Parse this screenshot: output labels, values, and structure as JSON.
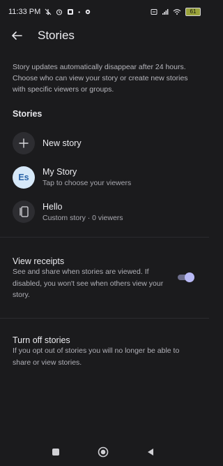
{
  "status_bar": {
    "time": "11:33 PM",
    "battery": "61"
  },
  "header": {
    "title": "Stories"
  },
  "intro_text": "Story updates automatically disappear after 24 hours. Choose who can view your story or create new stories with specific viewers or groups.",
  "stories_section": {
    "title": "Stories",
    "items": [
      {
        "primary": "New story",
        "secondary": "",
        "icon": "plus-icon"
      },
      {
        "primary": "My Story",
        "secondary": "Tap to choose your viewers",
        "avatar_text": "Es"
      },
      {
        "primary": "Hello",
        "secondary": "Custom story · 0 viewers",
        "icon": "custom-story-icon"
      }
    ]
  },
  "view_receipts": {
    "title": "View receipts",
    "description": "See and share when stories are viewed. If disabled, you won't see when others view your story.",
    "enabled": true,
    "accent_color": "#b8b9f5"
  },
  "turn_off_stories": {
    "title": "Turn off stories",
    "description": "If you opt out of stories you will no longer be able to share or view stories."
  },
  "nav_bar": {
    "buttons": [
      "recents-icon",
      "home-icon",
      "back-icon"
    ]
  }
}
